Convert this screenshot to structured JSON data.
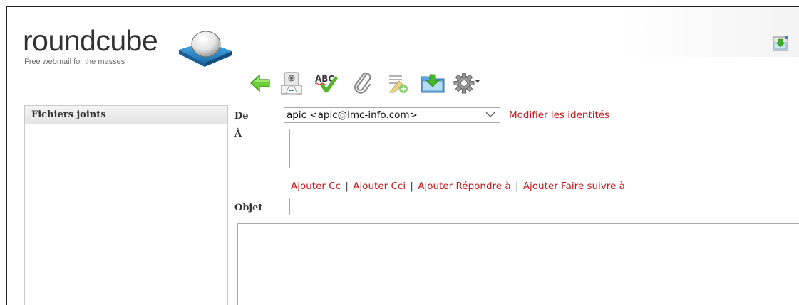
{
  "logo": {
    "name": "roundcube",
    "tagline": "Free webmail for the masses"
  },
  "toolbar": {
    "buttons": [
      {
        "icon": "back-arrow-icon",
        "label": "Back"
      },
      {
        "icon": "send-icon",
        "label": "Send"
      },
      {
        "icon": "spellcheck-icon",
        "label": "Spell check"
      },
      {
        "icon": "paperclip-icon",
        "label": "Attach"
      },
      {
        "icon": "signature-icon",
        "label": "Insert signature"
      },
      {
        "icon": "save-icon",
        "label": "Save"
      },
      {
        "icon": "gear-icon",
        "label": "Options"
      }
    ]
  },
  "sidebar": {
    "title": "Fichiers joints"
  },
  "compose": {
    "from_label": "De",
    "from_value": "apic <apic@lmc-info.com>",
    "modify_identities": "Modifier les identités",
    "to_label": "À",
    "add_links": [
      "Ajouter Cc",
      "Ajouter Cci",
      "Ajouter Répondre à",
      "Ajouter Faire suivre à"
    ],
    "subject_label": "Objet"
  },
  "colors": {
    "link": "#c11a1a",
    "border": "#a9a9a9",
    "accent_blue": "#2e8fd0",
    "accent_green": "#4fbf2e"
  }
}
